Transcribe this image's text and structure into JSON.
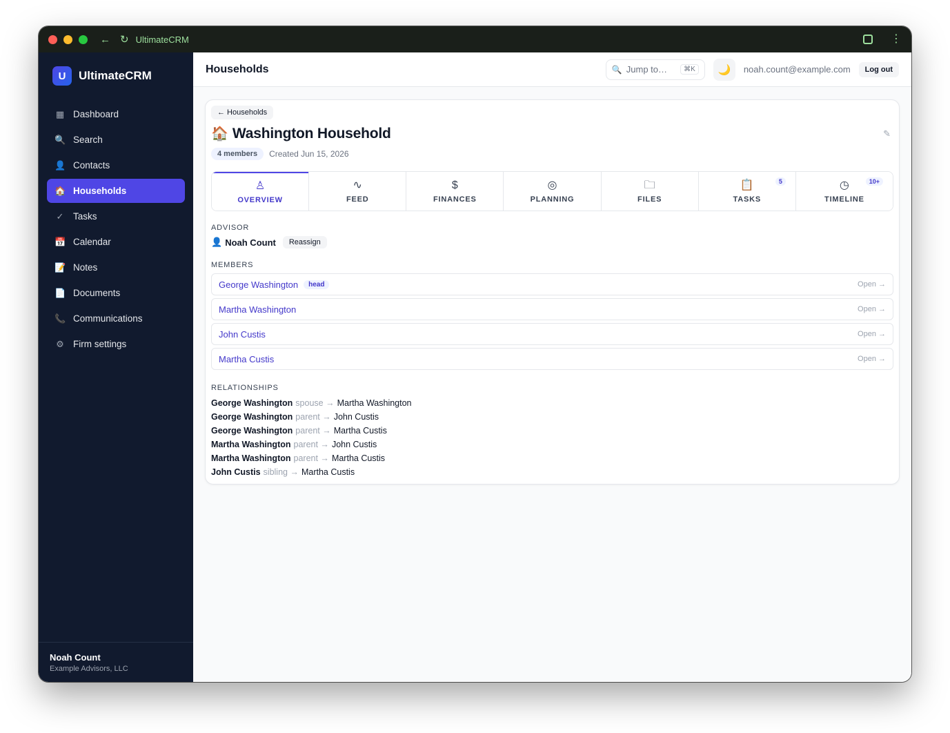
{
  "browser": {
    "title": "UltimateCRM",
    "back_icon": "arrow-left-icon",
    "reload_icon": "reload-icon",
    "extension_icon": "puzzle-icon",
    "menu_icon": "more-vertical-icon"
  },
  "sidebar": {
    "brand_letter": "U",
    "brand_name": "UltimateCRM",
    "items": [
      {
        "label": "Dashboard",
        "icon": "grid-icon",
        "glyph": "▦"
      },
      {
        "label": "Search",
        "icon": "search-icon",
        "glyph": "🔍"
      },
      {
        "label": "Contacts",
        "icon": "person-icon",
        "glyph": "👤"
      },
      {
        "label": "Households",
        "icon": "house-icon",
        "glyph": "🏠"
      },
      {
        "label": "Tasks",
        "icon": "checkmark-icon",
        "glyph": "✓"
      },
      {
        "label": "Calendar",
        "icon": "calendar-icon",
        "glyph": "📅"
      },
      {
        "label": "Notes",
        "icon": "notepad-icon",
        "glyph": "📝"
      },
      {
        "label": "Documents",
        "icon": "document-icon",
        "glyph": "📄"
      },
      {
        "label": "Communications",
        "icon": "phone-icon",
        "glyph": "📞"
      },
      {
        "label": "Firm settings",
        "icon": "gear-icon",
        "glyph": "⚙"
      }
    ],
    "active_item": "Households",
    "user_name": "Noah Count",
    "user_org": "Example Advisors, LLC"
  },
  "topbar": {
    "page_title": "Households",
    "jump_placeholder": "Jump to…",
    "jump_shortcut": "⌘K",
    "theme_glyph": "🌙",
    "user_email": "noah.count@example.com",
    "logout_label": "Log out"
  },
  "household": {
    "back_label": "← Households",
    "icon_glyph": "🏠",
    "title": "Washington Household",
    "edit_glyph": "✎",
    "members_count": "4 members",
    "created": "Created Jun 15, 2026"
  },
  "tabs": [
    {
      "label": "OVERVIEW",
      "icon": "person-icon",
      "glyph": "♙",
      "badge": ""
    },
    {
      "label": "FEED",
      "icon": "activity-icon",
      "glyph": "∿",
      "badge": ""
    },
    {
      "label": "FINANCES",
      "icon": "dollar-icon",
      "glyph": "$",
      "badge": ""
    },
    {
      "label": "PLANNING",
      "icon": "target-icon",
      "glyph": "◎",
      "badge": ""
    },
    {
      "label": "FILES",
      "icon": "folder-icon",
      "glyph": "🗀",
      "badge": ""
    },
    {
      "label": "TASKS",
      "icon": "clipboard-icon",
      "glyph": "📋",
      "badge": "5"
    },
    {
      "label": "TIMELINE",
      "icon": "clock-icon",
      "glyph": "◷",
      "badge": "10+"
    }
  ],
  "advisor": {
    "section_label": "ADVISOR",
    "glyph": "👤",
    "name": "Noah Count",
    "reassign_label": "Reassign"
  },
  "members": {
    "section_label": "MEMBERS",
    "open_label": "Open →",
    "items": [
      {
        "name": "George Washington",
        "badge": "head"
      },
      {
        "name": "Martha Washington",
        "badge": ""
      },
      {
        "name": "John Custis",
        "badge": ""
      },
      {
        "name": "Martha Custis",
        "badge": ""
      }
    ]
  },
  "relationships": {
    "section_label": "RELATIONSHIPS",
    "items": [
      {
        "from": "George Washington",
        "type": "spouse →",
        "to": "Martha Washington"
      },
      {
        "from": "George Washington",
        "type": "parent →",
        "to": "John Custis"
      },
      {
        "from": "George Washington",
        "type": "parent →",
        "to": "Martha Custis"
      },
      {
        "from": "Martha Washington",
        "type": "parent →",
        "to": "John Custis"
      },
      {
        "from": "Martha Washington",
        "type": "parent →",
        "to": "Martha Custis"
      },
      {
        "from": "John Custis",
        "type": "sibling →",
        "to": "Martha Custis"
      }
    ]
  }
}
